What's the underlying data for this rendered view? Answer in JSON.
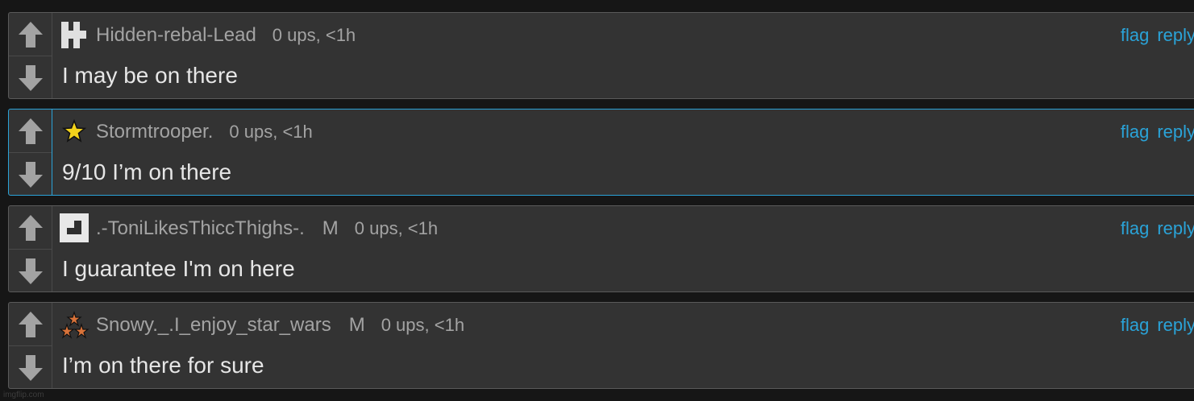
{
  "colors": {
    "background": "#161616",
    "card": "#333333",
    "link": "#2aa3d8",
    "highlight_border": "#2aa3d8"
  },
  "actions": {
    "flag": "flag",
    "reply": "reply"
  },
  "watermark": "imgflip.com",
  "comments": [
    {
      "avatar_icon": "tetris-block-avatar-icon",
      "username": "Hidden-rebal-Lead",
      "mod_badge": "",
      "ups": "0 ups, <1h",
      "text": "I may be on there",
      "highlighted": false
    },
    {
      "avatar_icon": "yellow-star-icon",
      "username": "Stormtrooper.",
      "mod_badge": "",
      "ups": "0 ups, <1h",
      "text": "9/10 I’m on there",
      "highlighted": true
    },
    {
      "avatar_icon": "square-block-avatar-icon",
      "username": ".-ToniLikesThiccThighs-.",
      "mod_badge": "M",
      "ups": "0 ups, <1h",
      "text": "I guarantee I'm on here",
      "highlighted": false
    },
    {
      "avatar_icon": "triple-star-icon",
      "username": "Snowy._.I_enjoy_star_wars",
      "mod_badge": "M",
      "ups": "0 ups, <1h",
      "text": "I’m on there for sure",
      "highlighted": false
    }
  ]
}
